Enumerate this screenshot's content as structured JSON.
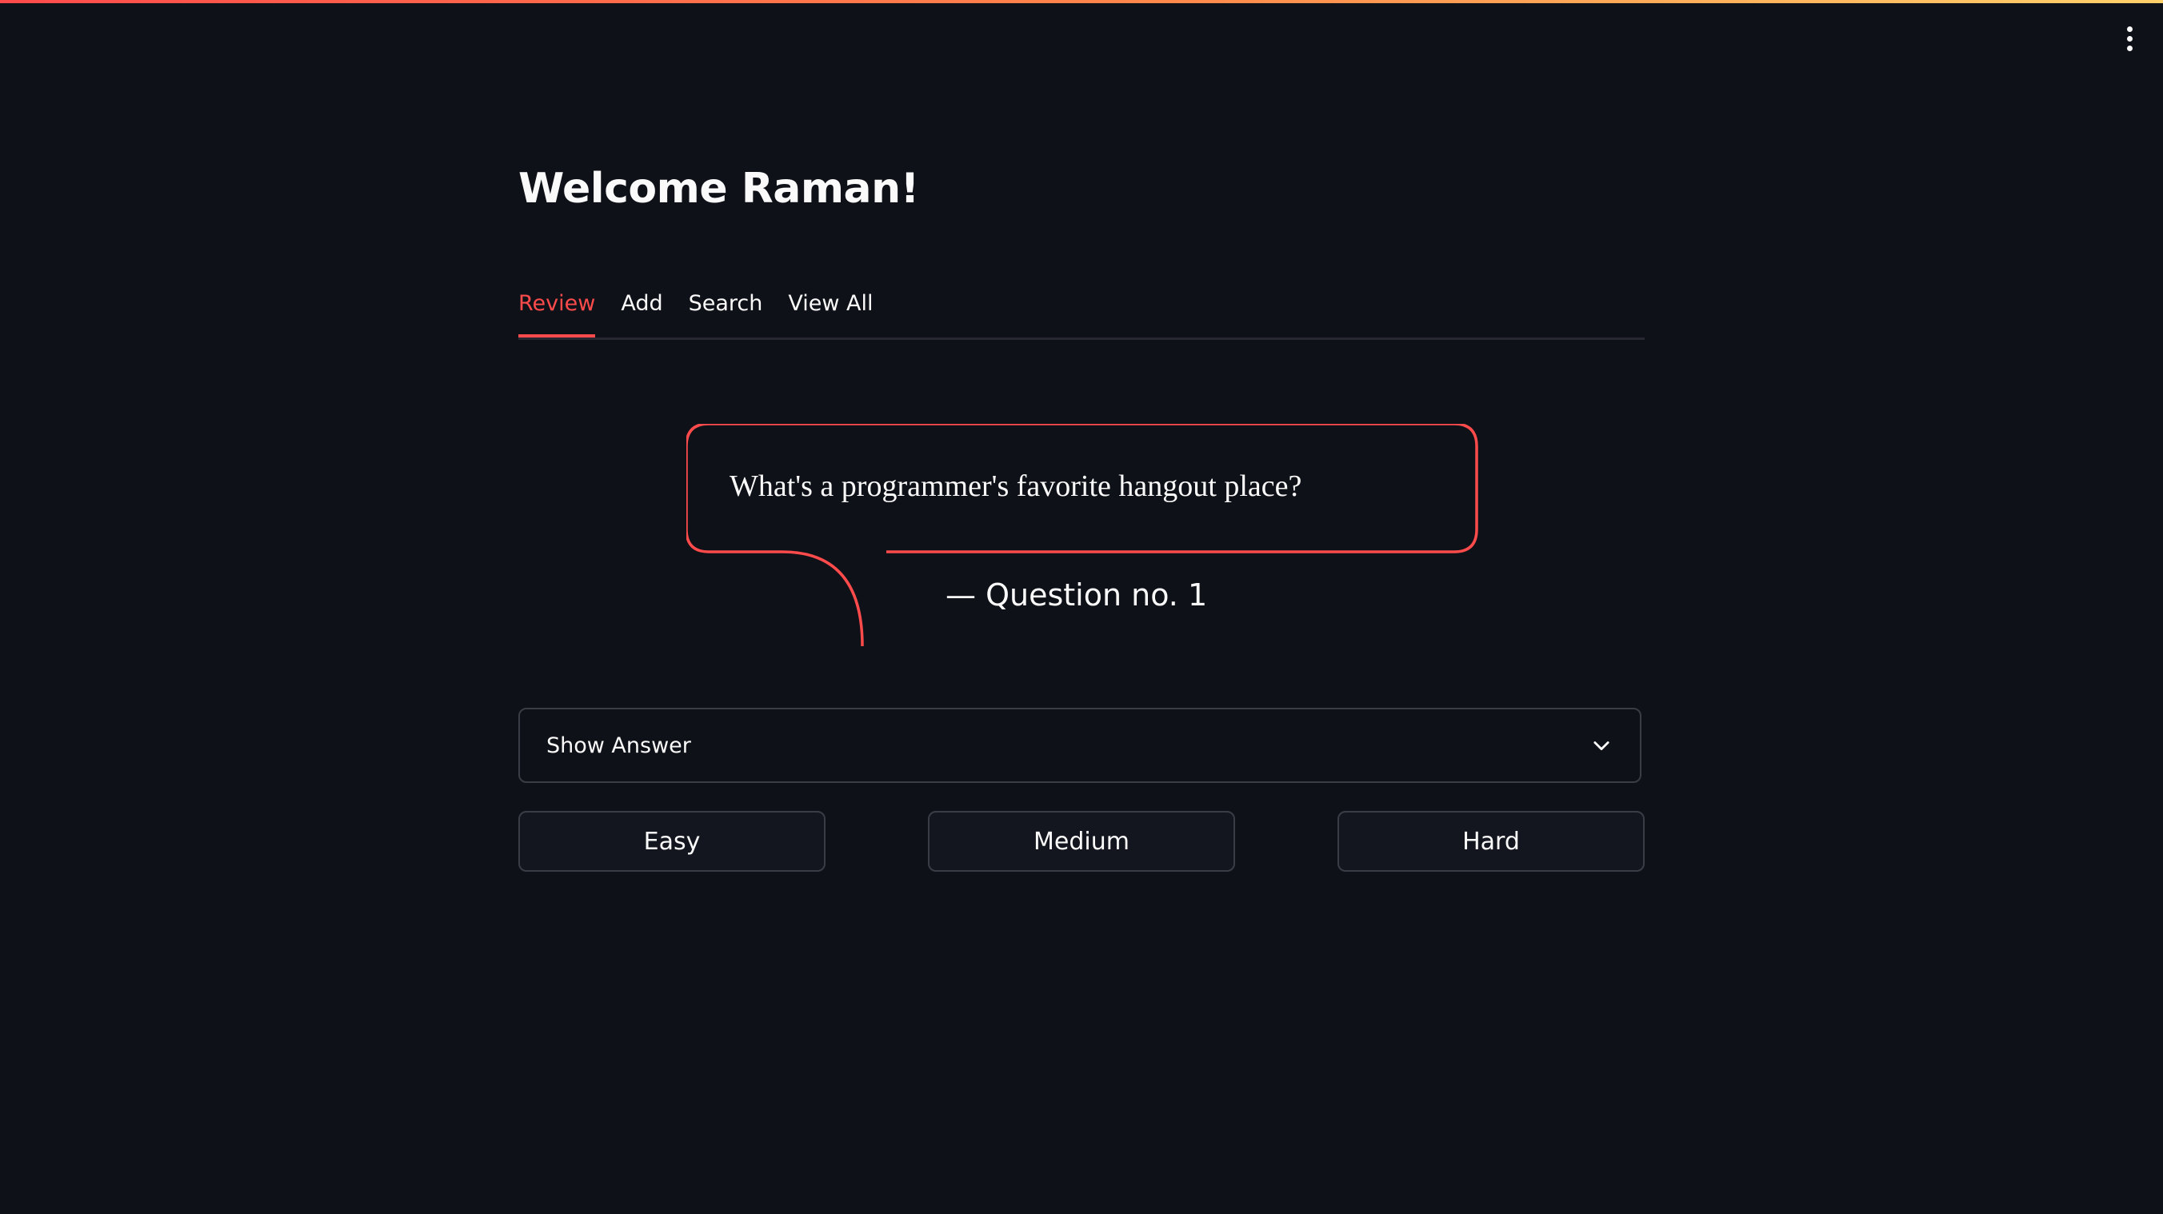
{
  "app": {
    "menu_icon": "vertical-ellipsis-icon",
    "accent_color": "#ff4b4b",
    "background_color": "#0e1117"
  },
  "header": {
    "title": "Welcome Raman!"
  },
  "tabs": [
    {
      "label": "Review",
      "active": true
    },
    {
      "label": "Add",
      "active": false
    },
    {
      "label": "Search",
      "active": false
    },
    {
      "label": "View All",
      "active": false
    }
  ],
  "card": {
    "question": "What's a programmer's favorite hangout place?",
    "caption": "— Question no. 1"
  },
  "answer_expander": {
    "label": "Show Answer",
    "icon": "chevron-down-icon"
  },
  "difficulty_buttons": {
    "easy": "Easy",
    "medium": "Medium",
    "hard": "Hard"
  }
}
